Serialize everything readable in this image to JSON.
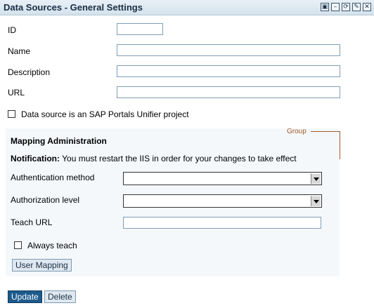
{
  "window": {
    "title": "Data Sources - General Settings",
    "buttons": [
      {
        "name": "restore-icon",
        "glyph": "▣"
      },
      {
        "name": "minimize-icon",
        "glyph": "–"
      },
      {
        "name": "refresh-icon",
        "glyph": "⟳"
      },
      {
        "name": "edit-icon",
        "glyph": "✎"
      },
      {
        "name": "close-icon",
        "glyph": "✕"
      }
    ]
  },
  "form": {
    "id_label": "ID",
    "id_value": "",
    "name_label": "Name",
    "name_value": "",
    "description_label": "Description",
    "description_value": "",
    "url_label": "URL",
    "url_value": "",
    "unifier_label": "Data source is an SAP Portals Unifier project",
    "unifier_checked": false
  },
  "group": {
    "label": "Group",
    "title": "Mapping Administration",
    "notification_bold": "Notification:",
    "notification_text": " You must restart the IIS in order for your changes to take effect",
    "auth_method_label": "Authentication method",
    "auth_method_value": "",
    "auth_level_label": "Authorization level",
    "auth_level_value": "",
    "teach_url_label": "Teach URL",
    "teach_url_value": "",
    "always_teach_label": "Always teach",
    "always_teach_checked": false,
    "user_mapping_button": "User Mapping"
  },
  "actions": {
    "update_button": "Update",
    "delete_button": "Delete"
  },
  "colors": {
    "titlebar": "#d4e2ec",
    "group_border": "#a05a2a",
    "primary_button": "#1e5a8c"
  }
}
